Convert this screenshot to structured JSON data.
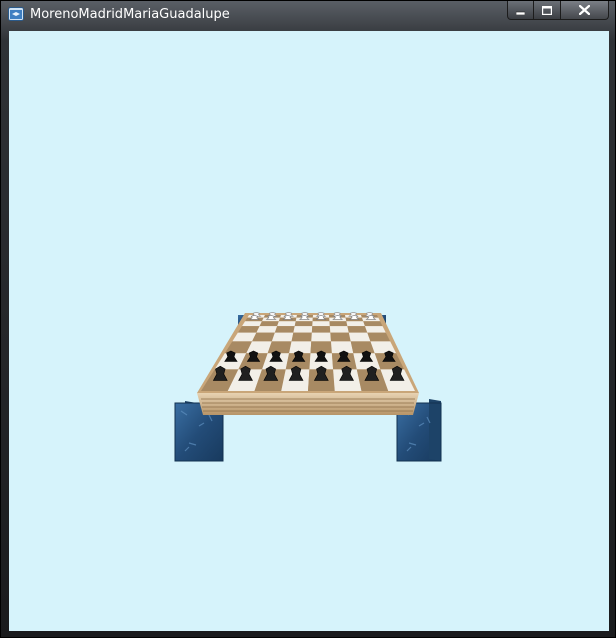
{
  "window": {
    "title": "MorenoMadridMariaGuadalupe",
    "icon": "app-window-icon",
    "controls": {
      "minimize_icon": "minimize-icon",
      "maximize_icon": "maximize-icon",
      "close_icon": "close-icon"
    }
  },
  "viewport": {
    "background": "#d6f3fb",
    "scene": {
      "board_light": "#f2efe8",
      "board_dark": "#a88a63",
      "frame": "#c9a679",
      "leg": "#244f7c",
      "pieces": [
        "white-pieces-back-row",
        "white-pawns",
        "black-pawns",
        "black-pieces-back-row"
      ]
    }
  }
}
